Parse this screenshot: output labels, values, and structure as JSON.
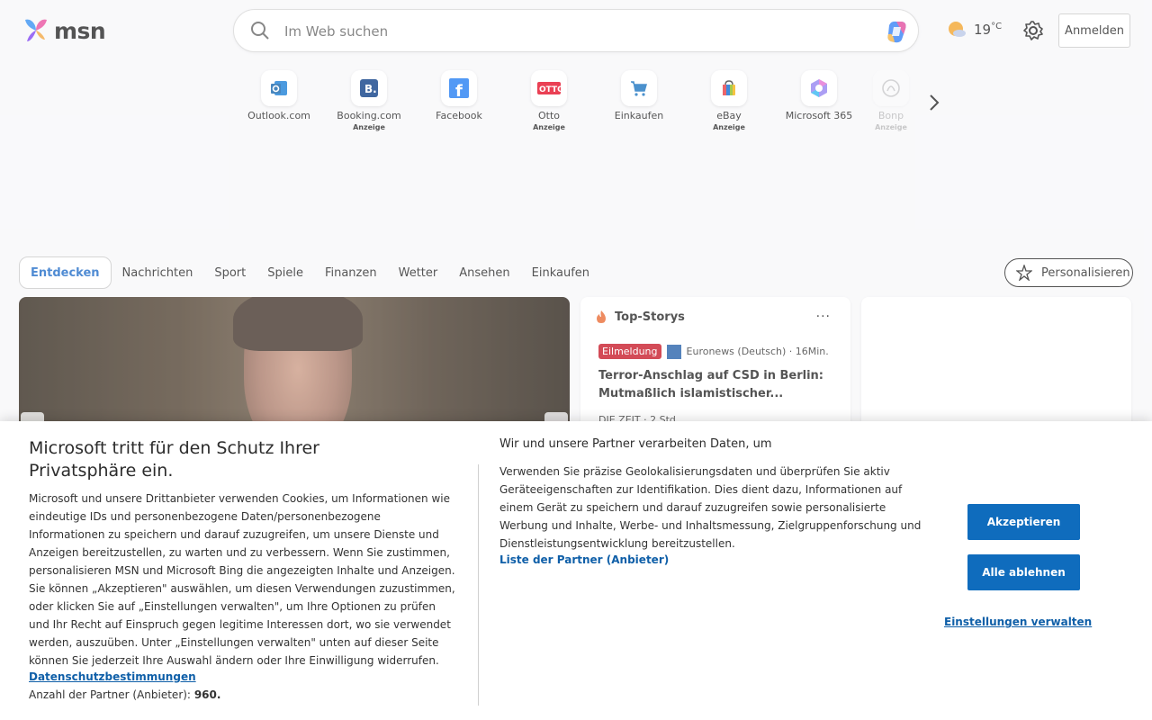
{
  "header": {
    "logo_text": "msn",
    "search_placeholder": "Im Web suchen",
    "weather_temp": "19",
    "weather_unit": "°C",
    "signin_label": "Anmelden"
  },
  "quicklinks": {
    "items": [
      {
        "name": "Outlook.com",
        "ad": ""
      },
      {
        "name": "Booking.com",
        "ad": "Anzeige"
      },
      {
        "name": "Facebook",
        "ad": ""
      },
      {
        "name": "Otto",
        "ad": "Anzeige"
      },
      {
        "name": "Einkaufen",
        "ad": ""
      },
      {
        "name": "eBay",
        "ad": "Anzeige"
      },
      {
        "name": "Microsoft 365",
        "ad": ""
      },
      {
        "name": "Bonp",
        "ad": "Anzeige"
      }
    ]
  },
  "nav": {
    "tabs": [
      "Entdecken",
      "Nachrichten",
      "Sport",
      "Spiele",
      "Finanzen",
      "Wetter",
      "Ansehen",
      "Einkaufen"
    ],
    "personalize_label": "Personalisieren"
  },
  "topstories": {
    "title": "Top-Storys",
    "more": "···",
    "badge": "Eilmeldung",
    "source": "Euronews (Deutsch) · 16Min.",
    "headline": "Terror-Anschlag auf CSD in Berlin: Mutmaßlich islamistischer...",
    "second_source": "DIE ZEIT · 2 Std."
  },
  "consent": {
    "title": "Microsoft tritt für den Schutz Ihrer Privatsphäre ein.",
    "body": "Microsoft und unsere Drittanbieter verwenden Cookies, um Informationen wie eindeutige IDs und personenbezogene Daten/personenbezogene Informationen zu speichern und darauf zuzugreifen, um unsere Dienste und Anzeigen bereitzustellen, zu warten und zu verbessern. Wenn Sie zustimmen, personalisieren MSN und Microsoft Bing die angezeigten Inhalte und Anzeigen. Sie können „Akzeptieren\" auswählen, um diesen Verwendungen zuzustimmen, oder klicken Sie auf „Einstellungen verwalten\", um Ihre Optionen zu prüfen und Ihr Recht auf Einspruch gegen legitime Interessen dort, wo sie verwendet werden, auszuüben. Unter „Einstellungen verwalten\" unten auf dieser Seite können Sie jederzeit Ihre Auswahl ändern oder Ihre Einwilligung widerrufen.",
    "privacy_link": "Datenschutzbestimmungen",
    "partner_count_label": "Anzahl der Partner (Anbieter):",
    "partner_count": "960.",
    "subtitle": "Wir und unsere Partner verarbeiten Daten, um",
    "purpose": "Verwenden Sie präzise Geolokalisierungsdaten und überprüfen Sie aktiv Geräteeigenschaften zur Identifikation. Dies dient dazu, Informationen auf einem Gerät zu speichern und darauf zuzugreifen sowie personalisierte Werbung und Inhalte, Werbe- und Inhaltsmessung, Zielgruppenforschung und Dienstleistungsentwicklung bereitzustellen.",
    "partners_link": "Liste der Partner (Anbieter)",
    "accept_label": "Akzeptieren",
    "reject_label": "Alle ablehnen",
    "settings_label": "Einstellungen verwalten"
  },
  "colors": {
    "accent": "#0f6cbd",
    "link": "#0f5fa8",
    "breaking": "#c50f1f"
  }
}
